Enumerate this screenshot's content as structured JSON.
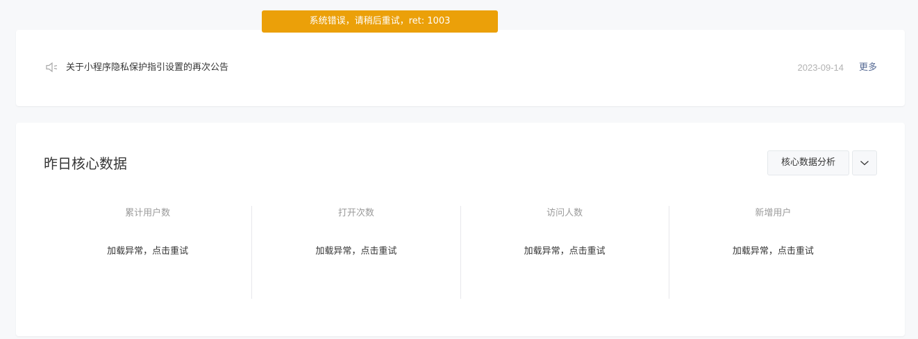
{
  "toast": {
    "message": "系统错误，请稍后重试，ret: 1003",
    "color": "#eba009"
  },
  "notice": {
    "icon": "speaker-icon",
    "title": "关于小程序隐私保护指引设置的再次公告",
    "date": "2023-09-14",
    "more_label": "更多"
  },
  "core_data": {
    "title": "昨日核心数据",
    "analysis_label": "核心数据分析",
    "dropdown_icon": "chevron-down-icon",
    "stats": [
      {
        "label": "累计用户数",
        "status": "加载异常，点击重试"
      },
      {
        "label": "打开次数",
        "status": "加载异常，点击重试"
      },
      {
        "label": "访问人数",
        "status": "加载异常，点击重试"
      },
      {
        "label": "新增用户",
        "status": "加载异常，点击重试"
      }
    ]
  },
  "colors": {
    "link": "#576b95",
    "background": "#f7f8fa"
  }
}
